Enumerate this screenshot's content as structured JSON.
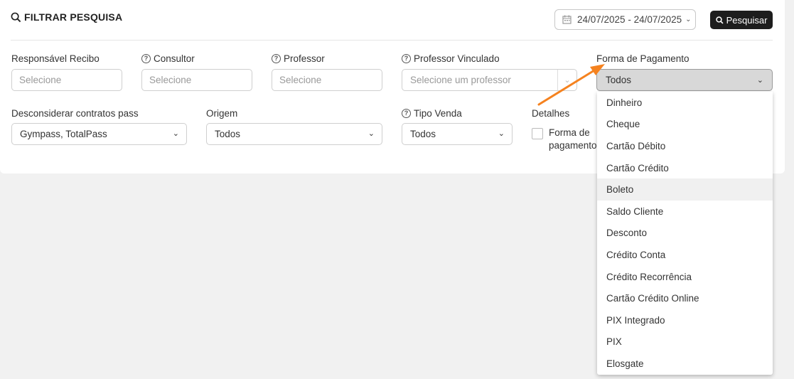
{
  "header": {
    "title": "FILTRAR PESQUISA",
    "date_range": "24/07/2025 - 24/07/2025",
    "search_button": "Pesquisar"
  },
  "filters": {
    "responsavel_recibo": {
      "label": "Responsável Recibo",
      "placeholder": "Selecione"
    },
    "consultor": {
      "label": "Consultor",
      "placeholder": "Selecione"
    },
    "professor": {
      "label": "Professor",
      "placeholder": "Selecione"
    },
    "professor_vinculado": {
      "label": "Professor Vinculado",
      "placeholder": "Selecione um professor"
    },
    "forma_pagamento": {
      "label": "Forma de Pagamento",
      "value": "Todos"
    },
    "desconsiderar": {
      "label": "Desconsiderar contratos pass",
      "value": "Gympass, TotalPass"
    },
    "origem": {
      "label": "Origem",
      "value": "Todos"
    },
    "tipo_venda": {
      "label": "Tipo Venda",
      "value": "Todos"
    },
    "detalhes": {
      "label": "Detalhes",
      "checkbox_label": "Forma de pagamento"
    }
  },
  "dropdown": {
    "options": [
      "Dinheiro",
      "Cheque",
      "Cartão Débito",
      "Cartão Crédito",
      "Boleto",
      "Saldo Cliente",
      "Desconto",
      "Crédito Conta",
      "Crédito Recorrência",
      "Cartão Crédito Online",
      "PIX Integrado",
      "PIX",
      "Elosgate"
    ],
    "highlighted": "Boleto"
  },
  "colors": {
    "annotation_arrow": "#f5821f",
    "button_bg": "#1d1d1d"
  }
}
